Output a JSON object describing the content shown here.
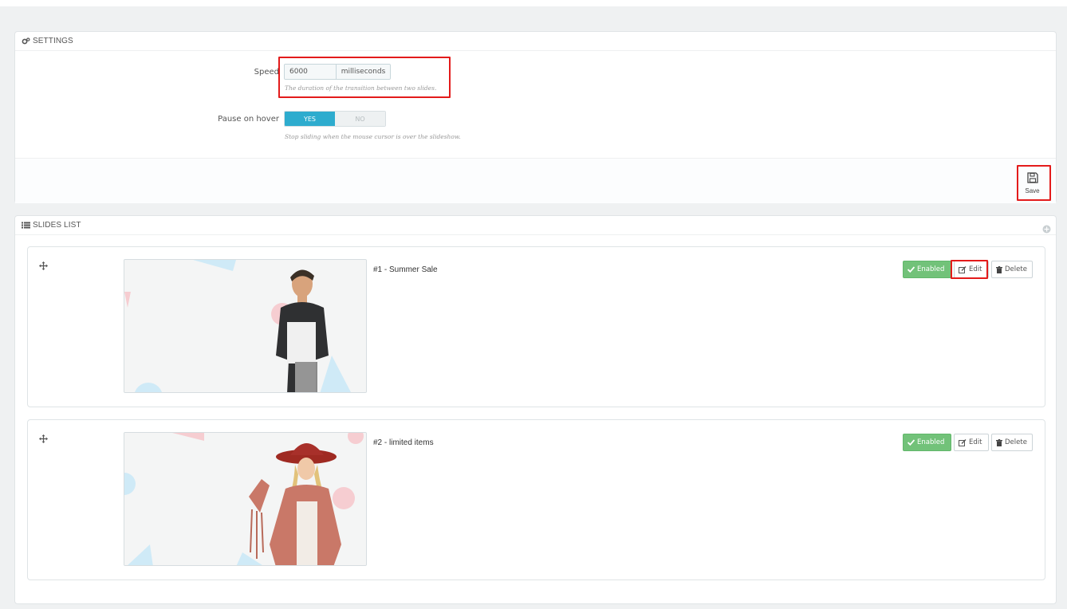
{
  "settings": {
    "title": "SETTINGS",
    "speed": {
      "label": "Speed",
      "value": "6000",
      "unit": "milliseconds",
      "help": "The duration of the transition between two slides."
    },
    "pause": {
      "label": "Pause on hover",
      "yes": "YES",
      "no": "NO",
      "selected": "YES",
      "help": "Stop sliding when the mouse cursor is over the slideshow."
    },
    "save_label": "Save"
  },
  "slides_list": {
    "title": "SLIDES LIST",
    "slides": [
      {
        "title": "#1 - Summer Sale",
        "enabled_label": "Enabled",
        "edit_label": "Edit",
        "delete_label": "Delete"
      },
      {
        "title": "#2 - limited items",
        "enabled_label": "Enabled",
        "edit_label": "Edit",
        "delete_label": "Delete"
      }
    ]
  },
  "colors": {
    "accent": "#2eacce",
    "enabled": "#72c279",
    "highlight": "#e31b1b"
  }
}
